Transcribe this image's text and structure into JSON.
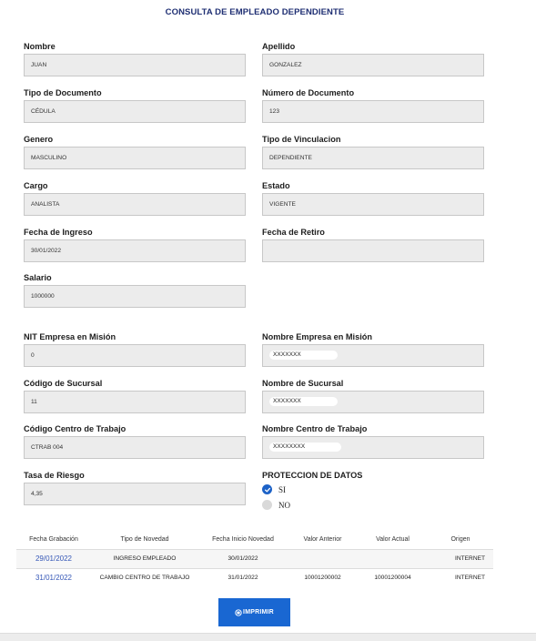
{
  "page": {
    "title": "CONSULTA DE EMPLEADO DEPENDIENTE"
  },
  "form": {
    "nombre": {
      "label": "Nombre",
      "value": "JUAN"
    },
    "apellido": {
      "label": "Apellido",
      "value": "GONZALEZ"
    },
    "tipo_documento": {
      "label": "Tipo de Documento",
      "value": "CÉDULA"
    },
    "numero_documento": {
      "label": "Número de Documento",
      "value": "123"
    },
    "genero": {
      "label": "Genero",
      "value": "MASCULINO"
    },
    "tipo_vinculacion": {
      "label": "Tipo de Vinculacion",
      "value": "DEPENDIENTE"
    },
    "cargo": {
      "label": "Cargo",
      "value": "ANALISTA"
    },
    "estado": {
      "label": "Estado",
      "value": "VIGENTE"
    },
    "fecha_ingreso": {
      "label": "Fecha de Ingreso",
      "value": "30/01/2022"
    },
    "fecha_retiro": {
      "label": "Fecha de Retiro",
      "value": ""
    },
    "salario": {
      "label": "Salario",
      "value": "1000000"
    },
    "nit_empresa": {
      "label": "NIT Empresa en Misión",
      "value": "0"
    },
    "nombre_empresa": {
      "label": "Nombre Empresa en Misión",
      "value": "XXXXXXX"
    },
    "codigo_sucursal": {
      "label": "Código de Sucursal",
      "value": "11"
    },
    "nombre_sucursal": {
      "label": "Nombre de Sucursal",
      "value": "XXXXXXX"
    },
    "codigo_centro": {
      "label": "Código Centro de Trabajo",
      "value": "CTRAB 004"
    },
    "nombre_centro": {
      "label": "Nombre Centro de Trabajo",
      "value": "XXXXXXXX"
    },
    "tasa_riesgo": {
      "label": "Tasa de Riesgo",
      "value": "4,35"
    }
  },
  "proteccion_datos": {
    "label": "PROTECCION DE DATOS",
    "options": [
      {
        "label": "SI",
        "selected": true
      },
      {
        "label": "NO",
        "selected": false
      }
    ]
  },
  "history": {
    "headers": [
      "Fecha Grabación",
      "Tipo de Novedad",
      "Fecha Inicio Novedad",
      "Valor Anterior",
      "Valor Actual",
      "Origen"
    ],
    "rows": [
      [
        "29/01/2022",
        "INGRESO EMPLEADO",
        "30/01/2022",
        "",
        "",
        "INTERNET"
      ],
      [
        "31/01/2022",
        "CAMBIO CENTRO DE TRABAJO",
        "31/01/2022",
        "10001200002",
        "10001200004",
        "INTERNET"
      ]
    ]
  },
  "actions": {
    "print_label": "IMPRIMIR",
    "print_icon": "print-icon"
  },
  "colors": {
    "title": "#1f2f73",
    "button": "#1967d2",
    "radio_selected": "#1d62c7",
    "link_date": "#3557b7",
    "field_bg": "#ececec"
  }
}
